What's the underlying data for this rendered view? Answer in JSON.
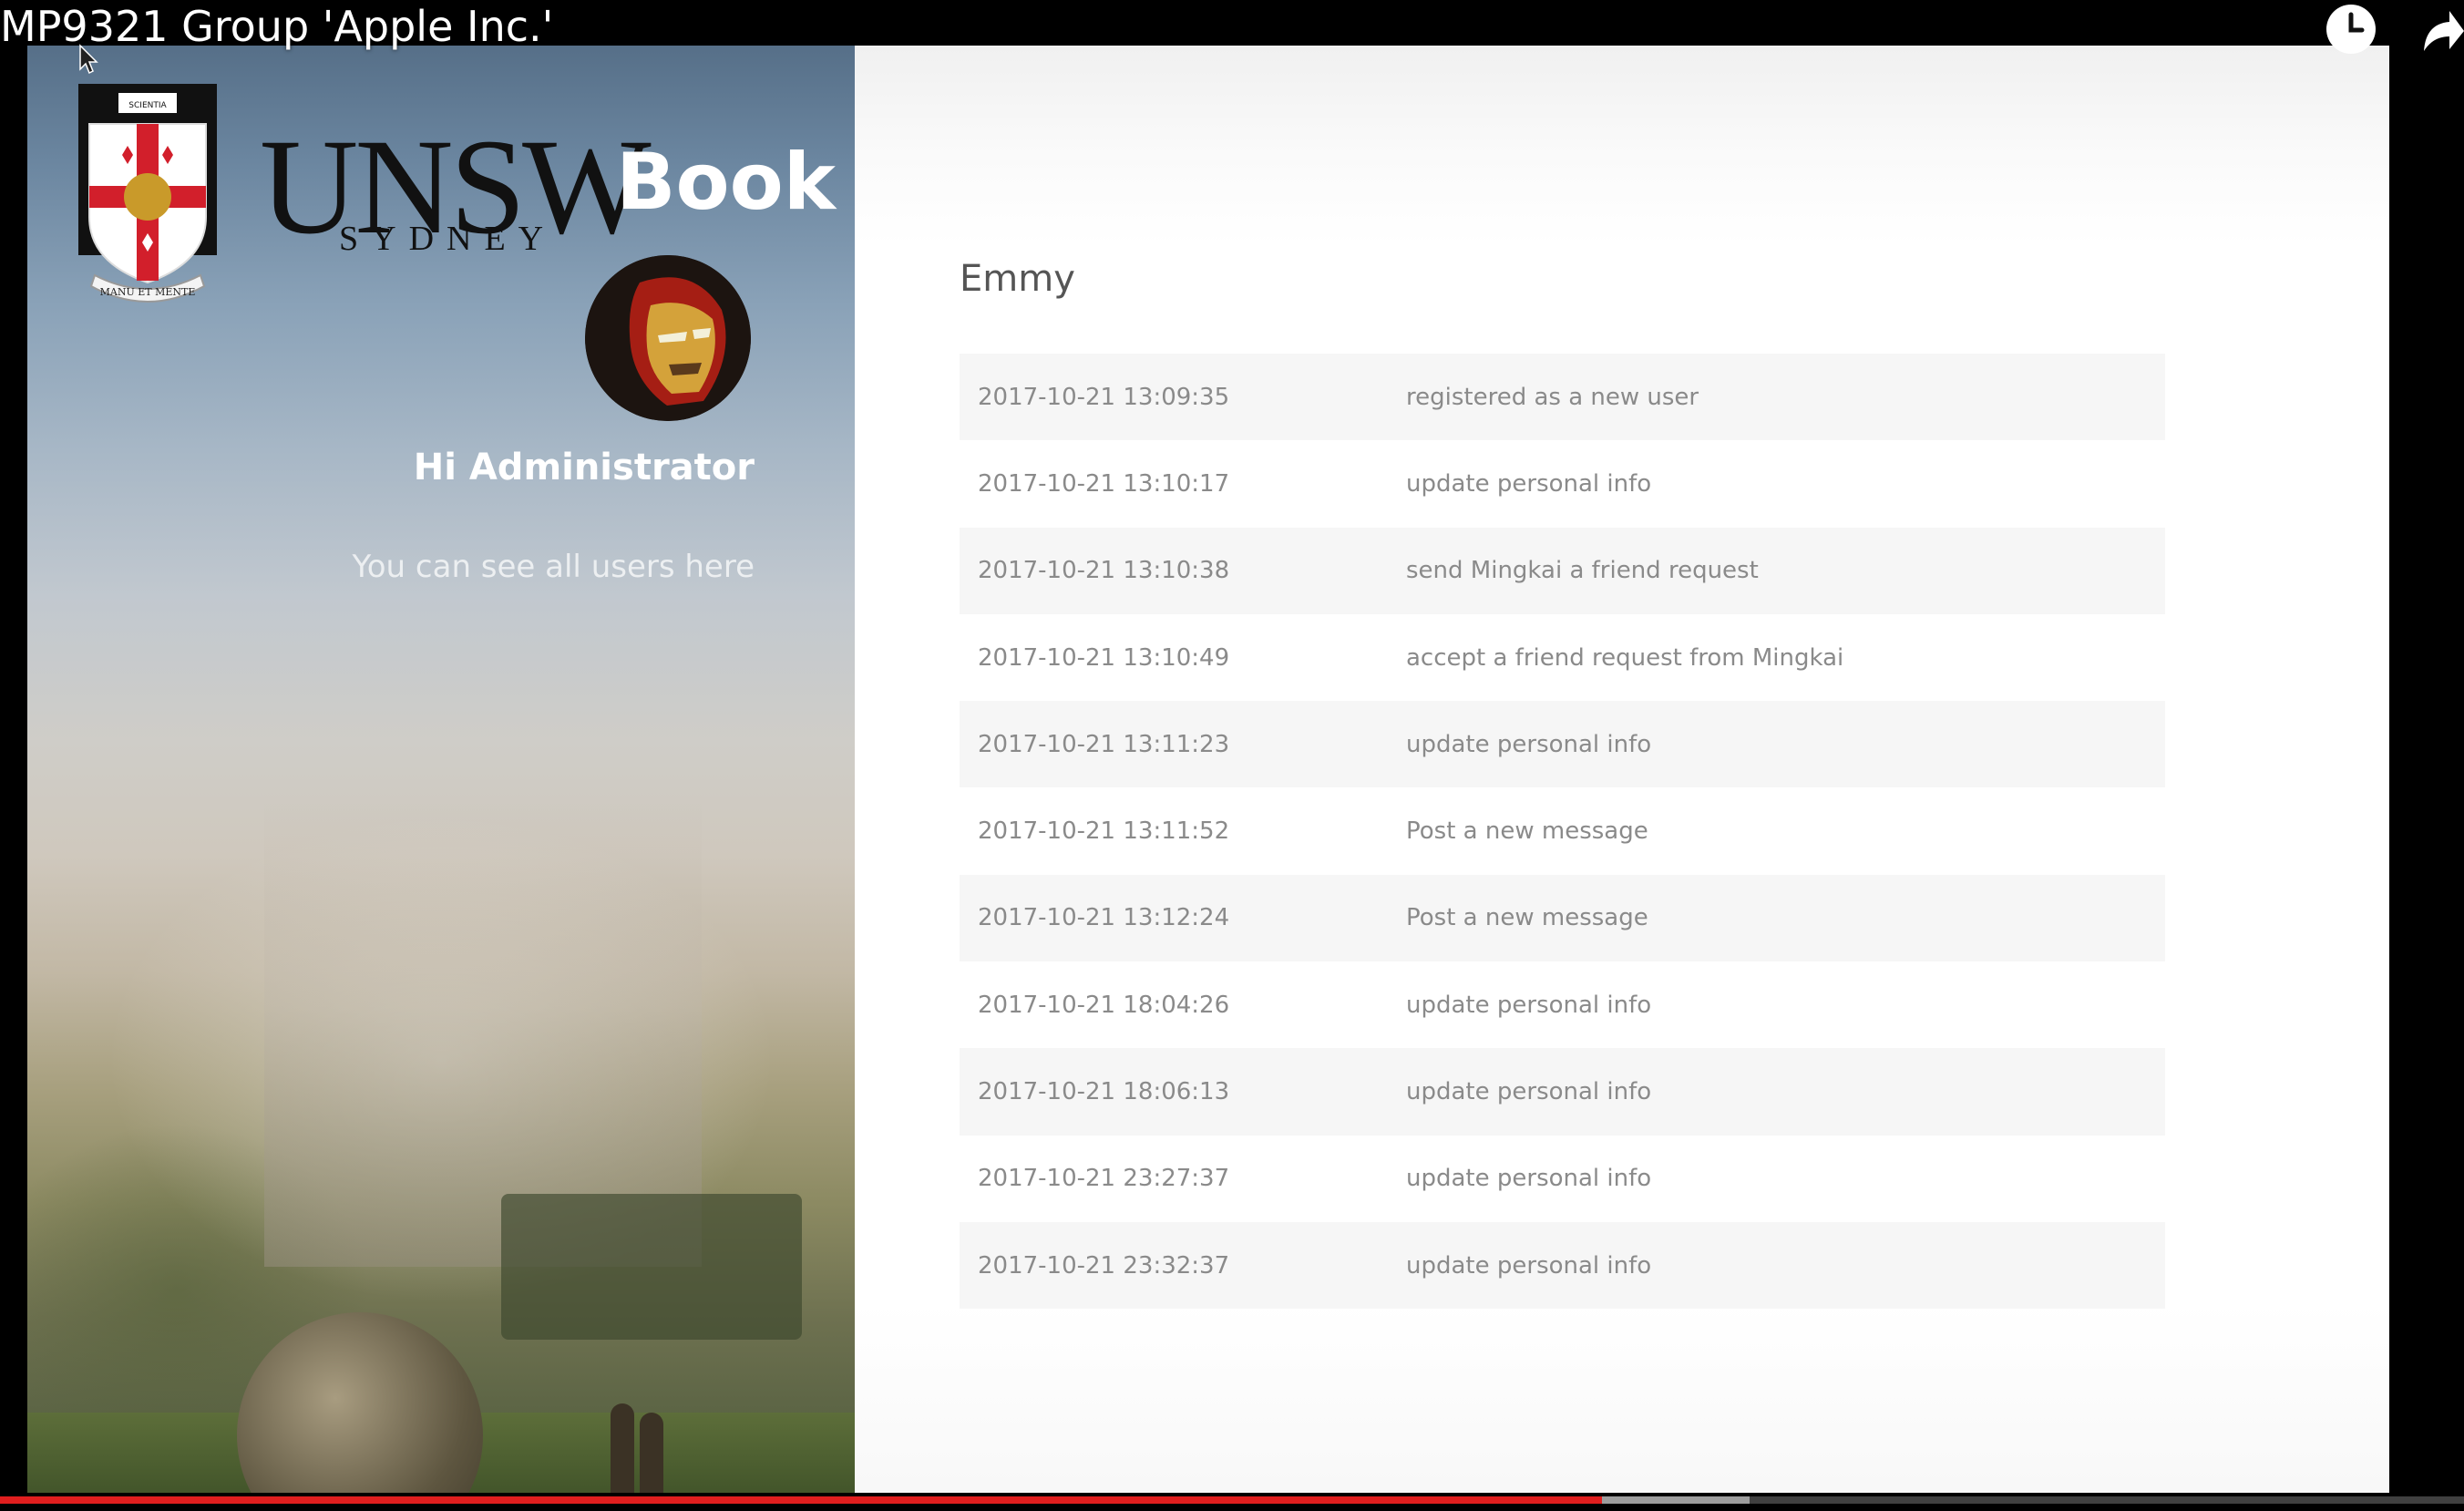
{
  "video": {
    "title": "MP9321 Group 'Apple Inc.'",
    "progress_played": 0.65,
    "progress_buffered": 0.71
  },
  "icons": {
    "watch_later": "clock-icon",
    "share": "share-arrow-icon",
    "cursor": "mouse-cursor-icon"
  },
  "sidebar": {
    "logo": {
      "main": "UNSW",
      "suffix": "Book",
      "city": "SYDNEY",
      "crest_banner": "SCIENTIA",
      "crest_motto": "MANU ET MENTE"
    },
    "greeting": "Hi Administrator",
    "subtitle": "You can see all users here"
  },
  "main": {
    "user_name": "Emmy",
    "activities": [
      {
        "time": "2017-10-21 13:09:35",
        "action": "registered as a new user"
      },
      {
        "time": "2017-10-21 13:10:17",
        "action": "update personal info"
      },
      {
        "time": "2017-10-21 13:10:38",
        "action": "send Mingkai a friend request"
      },
      {
        "time": "2017-10-21 13:10:49",
        "action": "accept a friend request from Mingkai"
      },
      {
        "time": "2017-10-21 13:11:23",
        "action": "update personal info"
      },
      {
        "time": "2017-10-21 13:11:52",
        "action": "Post a new message"
      },
      {
        "time": "2017-10-21 13:12:24",
        "action": "Post a new message"
      },
      {
        "time": "2017-10-21 18:04:26",
        "action": "update personal info"
      },
      {
        "time": "2017-10-21 18:06:13",
        "action": "update personal info"
      },
      {
        "time": "2017-10-21 23:27:37",
        "action": "update personal info"
      },
      {
        "time": "2017-10-21 23:32:37",
        "action": "update personal info"
      }
    ]
  },
  "colors": {
    "accent_red": "#e01e1e",
    "crest_red": "#d21f2b",
    "text_muted": "#8a8a8a"
  }
}
